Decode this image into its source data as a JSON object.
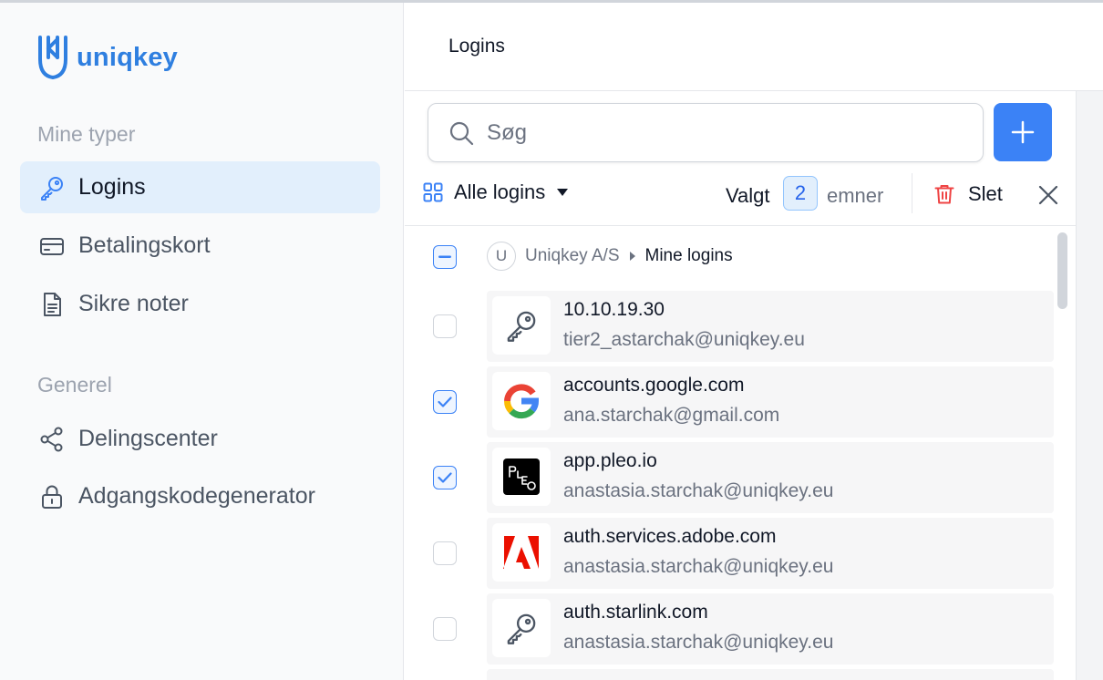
{
  "brand": {
    "name": "uniqkey",
    "color": "#2f7fe0"
  },
  "sidebar": {
    "sections": [
      {
        "title": "Mine typer",
        "items": [
          {
            "label": "Logins",
            "icon": "key-icon",
            "active": true
          },
          {
            "label": "Betalingskort",
            "icon": "credit-card-icon",
            "active": false
          },
          {
            "label": "Sikre noter",
            "icon": "document-icon",
            "active": false
          }
        ]
      },
      {
        "title": "Generel",
        "items": [
          {
            "label": "Delingscenter",
            "icon": "share-icon",
            "active": false
          },
          {
            "label": "Adgangskodegenerator",
            "icon": "lock-icon",
            "active": false
          }
        ]
      }
    ]
  },
  "header": {
    "title": "Logins"
  },
  "search": {
    "placeholder": "Søg"
  },
  "toolbar": {
    "filter_label": "Alle logins",
    "selected_prefix": "Valgt",
    "selected_count": "2",
    "selected_suffix": "emner",
    "delete_label": "Slet"
  },
  "group": {
    "avatar": "U",
    "organization": "Uniqkey A/S",
    "folder": "Mine logins"
  },
  "logins": [
    {
      "name": "10.10.19.30",
      "username": "tier2_astarchak@uniqkey.eu",
      "icon": "key-icon",
      "checked": false
    },
    {
      "name": "accounts.google.com",
      "username": "ana.starchak@gmail.com",
      "icon": "google-logo-icon",
      "checked": true
    },
    {
      "name": "app.pleo.io",
      "username": "anastasia.starchak@uniqkey.eu",
      "icon": "pleo-logo-icon",
      "checked": true
    },
    {
      "name": "auth.services.adobe.com",
      "username": "anastasia.starchak@uniqkey.eu",
      "icon": "adobe-logo-icon",
      "checked": false
    },
    {
      "name": "auth.starlink.com",
      "username": "anastasia.starchak@uniqkey.eu",
      "icon": "key-icon",
      "checked": false
    }
  ],
  "colors": {
    "accent": "#3b82f6",
    "active_bg": "#e2effc",
    "danger": "#ef4444"
  }
}
